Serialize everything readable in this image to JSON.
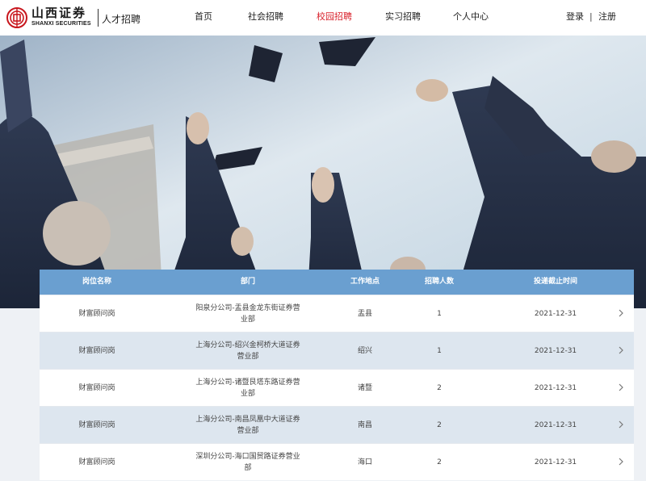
{
  "header": {
    "logo_cn": "山西证券",
    "logo_en": "SHANXI SECURITIES",
    "logo_sub": "人才招聘",
    "nav": [
      {
        "label": "首页",
        "active": false
      },
      {
        "label": "社会招聘",
        "active": false
      },
      {
        "label": "校园招聘",
        "active": true
      },
      {
        "label": "实习招聘",
        "active": false
      },
      {
        "label": "个人中心",
        "active": false
      }
    ],
    "login": "登录",
    "separator": "|",
    "register": "注册"
  },
  "colors": {
    "accent": "#d8202a",
    "table_header": "#6a9fd0",
    "row_alt": "#dde6ef"
  },
  "table": {
    "columns": [
      "岗位名称",
      "部门",
      "工作地点",
      "招聘人数",
      "投递截止时间"
    ],
    "rows": [
      {
        "position": "财富顾问岗",
        "department": "阳泉分公司-盂县金龙东街证券营业部",
        "location": "盂县",
        "headcount": "1",
        "deadline": "2021-12-31"
      },
      {
        "position": "财富顾问岗",
        "department": "上海分公司-绍兴金柯桥大道证券营业部",
        "location": "绍兴",
        "headcount": "1",
        "deadline": "2021-12-31"
      },
      {
        "position": "财富顾问岗",
        "department": "上海分公司-诸暨艮塔东路证券营业部",
        "location": "诸暨",
        "headcount": "2",
        "deadline": "2021-12-31"
      },
      {
        "position": "财富顾问岗",
        "department": "上海分公司-南昌凤凰中大道证券营业部",
        "location": "南昌",
        "headcount": "2",
        "deadline": "2021-12-31"
      },
      {
        "position": "财富顾问岗",
        "department": "深圳分公司-海口国贸路证券营业部",
        "location": "海口",
        "headcount": "2",
        "deadline": "2021-12-31"
      }
    ]
  }
}
